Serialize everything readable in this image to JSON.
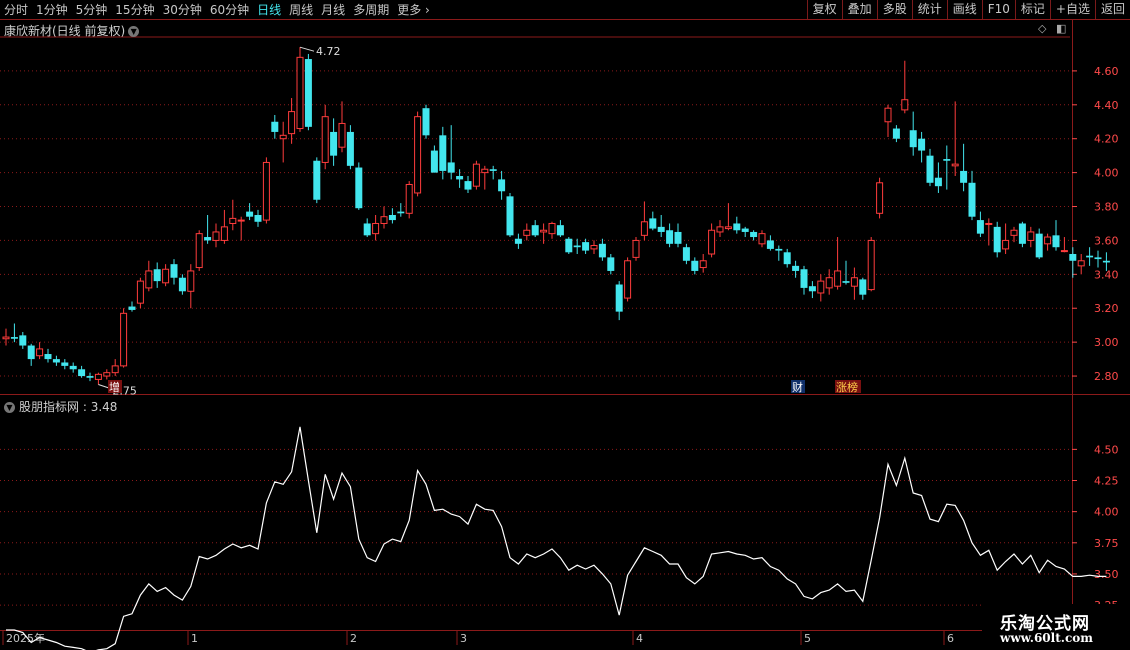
{
  "toolbar": {
    "periods": [
      "分时",
      "1分钟",
      "5分钟",
      "15分钟",
      "30分钟",
      "60分钟",
      "日线",
      "周线",
      "月线",
      "多周期",
      "更多"
    ],
    "active_period": "日线",
    "more_chevron": "›",
    "tools": [
      "复权",
      "叠加",
      "多股",
      "统计",
      "画线",
      "F10",
      "标记",
      "+自选",
      "返回"
    ]
  },
  "main_panel": {
    "title": "康欣新材(日线 前复权)",
    "y_ticks": [
      "4.60",
      "4.40",
      "4.20",
      "4.00",
      "3.80",
      "3.60",
      "3.40",
      "3.20",
      "3.00",
      "2.80"
    ],
    "high_label": "4.72",
    "low_label": "2.75",
    "markers": {
      "zeng": "增",
      "cai": "财",
      "zhangbang": "涨榜"
    }
  },
  "indicator_panel": {
    "title": "股朋指标网",
    "value": "3.48",
    "y_ticks": [
      "4.50",
      "4.25",
      "4.00",
      "3.75",
      "3.50",
      "3.25"
    ]
  },
  "x_axis": {
    "labels": [
      "2025年",
      "1",
      "2",
      "3",
      "4",
      "5",
      "6"
    ]
  },
  "watermark": {
    "line1": "乐淘公式网",
    "line2": "www.60lt.com"
  },
  "colors": {
    "up": "#ff3c3c",
    "down": "#43e6ee",
    "grid": "#8b1a1a",
    "line": "#ffffff",
    "tick": "#ff4a4a"
  },
  "chart_data": [
    {
      "type": "candlestick",
      "title": "康欣新材(日线 前复权)",
      "ylim": [
        2.7,
        4.8
      ],
      "columns": [
        "open",
        "high",
        "low",
        "close"
      ],
      "ohlc": [
        [
          3.02,
          3.08,
          2.98,
          3.03
        ],
        [
          3.03,
          3.11,
          3.0,
          3.02
        ],
        [
          3.04,
          3.06,
          2.96,
          2.98
        ],
        [
          2.98,
          2.99,
          2.86,
          2.9
        ],
        [
          2.92,
          3.0,
          2.9,
          2.96
        ],
        [
          2.93,
          2.96,
          2.88,
          2.9
        ],
        [
          2.9,
          2.92,
          2.86,
          2.88
        ],
        [
          2.88,
          2.9,
          2.84,
          2.86
        ],
        [
          2.86,
          2.88,
          2.82,
          2.84
        ],
        [
          2.84,
          2.86,
          2.79,
          2.8
        ],
        [
          2.8,
          2.82,
          2.77,
          2.79
        ],
        [
          2.78,
          2.82,
          2.75,
          2.81
        ],
        [
          2.8,
          2.84,
          2.78,
          2.82
        ],
        [
          2.82,
          2.9,
          2.8,
          2.86
        ],
        [
          2.86,
          3.2,
          2.85,
          3.17
        ],
        [
          3.21,
          3.24,
          3.18,
          3.19
        ],
        [
          3.23,
          3.38,
          3.2,
          3.36
        ],
        [
          3.32,
          3.48,
          3.3,
          3.42
        ],
        [
          3.43,
          3.47,
          3.32,
          3.36
        ],
        [
          3.35,
          3.46,
          3.33,
          3.43
        ],
        [
          3.46,
          3.49,
          3.34,
          3.38
        ],
        [
          3.38,
          3.4,
          3.28,
          3.3
        ],
        [
          3.3,
          3.46,
          3.2,
          3.42
        ],
        [
          3.44,
          3.66,
          3.42,
          3.64
        ],
        [
          3.62,
          3.75,
          3.58,
          3.6
        ],
        [
          3.6,
          3.7,
          3.56,
          3.65
        ],
        [
          3.6,
          3.78,
          3.58,
          3.68
        ],
        [
          3.7,
          3.84,
          3.66,
          3.73
        ],
        [
          3.72,
          3.74,
          3.6,
          3.72
        ],
        [
          3.77,
          3.82,
          3.72,
          3.74
        ],
        [
          3.75,
          3.78,
          3.68,
          3.71
        ],
        [
          3.72,
          4.09,
          3.7,
          4.06
        ],
        [
          4.3,
          4.34,
          4.2,
          4.24
        ],
        [
          4.2,
          4.3,
          4.06,
          4.22
        ],
        [
          4.23,
          4.44,
          4.17,
          4.36
        ],
        [
          4.26,
          4.74,
          4.24,
          4.68
        ],
        [
          4.67,
          4.7,
          4.25,
          4.27
        ],
        [
          4.07,
          4.09,
          3.82,
          3.84
        ],
        [
          4.06,
          4.4,
          4.02,
          4.33
        ],
        [
          4.24,
          4.32,
          4.04,
          4.1
        ],
        [
          4.15,
          4.42,
          4.12,
          4.29
        ],
        [
          4.24,
          4.28,
          4.02,
          4.04
        ],
        [
          4.03,
          4.06,
          3.78,
          3.79
        ],
        [
          3.7,
          3.73,
          3.62,
          3.63
        ],
        [
          3.64,
          3.75,
          3.6,
          3.7
        ],
        [
          3.7,
          3.8,
          3.67,
          3.74
        ],
        [
          3.75,
          3.79,
          3.7,
          3.72
        ],
        [
          3.77,
          3.82,
          3.74,
          3.76
        ],
        [
          3.76,
          3.95,
          3.73,
          3.93
        ],
        [
          3.88,
          4.36,
          3.86,
          4.33
        ],
        [
          4.38,
          4.4,
          4.2,
          4.22
        ],
        [
          4.13,
          4.16,
          4.0,
          4.0
        ],
        [
          4.22,
          4.27,
          3.96,
          4.01
        ],
        [
          4.06,
          4.28,
          3.96,
          4.0
        ],
        [
          3.98,
          4.02,
          3.91,
          3.96
        ],
        [
          3.95,
          3.98,
          3.88,
          3.9
        ],
        [
          3.92,
          4.07,
          3.9,
          4.05
        ],
        [
          4.0,
          4.04,
          3.9,
          4.02
        ],
        [
          4.02,
          4.04,
          3.96,
          4.01
        ],
        [
          3.96,
          4.01,
          3.84,
          3.89
        ],
        [
          3.86,
          3.88,
          3.62,
          3.63
        ],
        [
          3.61,
          3.64,
          3.55,
          3.58
        ],
        [
          3.63,
          3.7,
          3.6,
          3.66
        ],
        [
          3.69,
          3.72,
          3.62,
          3.63
        ],
        [
          3.65,
          3.7,
          3.58,
          3.66
        ],
        [
          3.64,
          3.71,
          3.61,
          3.7
        ],
        [
          3.69,
          3.72,
          3.62,
          3.63
        ],
        [
          3.61,
          3.62,
          3.52,
          3.53
        ],
        [
          3.57,
          3.61,
          3.52,
          3.56
        ],
        [
          3.59,
          3.61,
          3.52,
          3.54
        ],
        [
          3.55,
          3.6,
          3.52,
          3.57
        ],
        [
          3.58,
          3.61,
          3.48,
          3.5
        ],
        [
          3.5,
          3.52,
          3.4,
          3.42
        ],
        [
          3.34,
          3.36,
          3.13,
          3.18
        ],
        [
          3.26,
          3.5,
          3.24,
          3.48
        ],
        [
          3.5,
          3.62,
          3.48,
          3.6
        ],
        [
          3.63,
          3.83,
          3.6,
          3.71
        ],
        [
          3.73,
          3.77,
          3.66,
          3.67
        ],
        [
          3.68,
          3.75,
          3.62,
          3.65
        ],
        [
          3.66,
          3.7,
          3.56,
          3.58
        ],
        [
          3.65,
          3.7,
          3.56,
          3.58
        ],
        [
          3.56,
          3.58,
          3.46,
          3.48
        ],
        [
          3.48,
          3.5,
          3.4,
          3.42
        ],
        [
          3.44,
          3.52,
          3.41,
          3.48
        ],
        [
          3.52,
          3.7,
          3.5,
          3.66
        ],
        [
          3.65,
          3.72,
          3.62,
          3.68
        ],
        [
          3.67,
          3.82,
          3.66,
          3.68
        ],
        [
          3.7,
          3.74,
          3.64,
          3.66
        ],
        [
          3.67,
          3.68,
          3.62,
          3.65
        ],
        [
          3.65,
          3.66,
          3.6,
          3.62
        ],
        [
          3.58,
          3.66,
          3.56,
          3.64
        ],
        [
          3.6,
          3.63,
          3.54,
          3.55
        ],
        [
          3.55,
          3.57,
          3.48,
          3.54
        ],
        [
          3.53,
          3.55,
          3.44,
          3.46
        ],
        [
          3.45,
          3.48,
          3.38,
          3.42
        ],
        [
          3.43,
          3.45,
          3.28,
          3.32
        ],
        [
          3.33,
          3.36,
          3.26,
          3.3
        ],
        [
          3.29,
          3.4,
          3.24,
          3.36
        ],
        [
          3.32,
          3.43,
          3.28,
          3.38
        ],
        [
          3.33,
          3.62,
          3.31,
          3.42
        ],
        [
          3.36,
          3.48,
          3.34,
          3.35
        ],
        [
          3.33,
          3.44,
          3.25,
          3.38
        ],
        [
          3.37,
          3.38,
          3.25,
          3.28
        ],
        [
          3.31,
          3.62,
          3.3,
          3.6
        ],
        [
          3.76,
          3.97,
          3.73,
          3.94
        ],
        [
          4.3,
          4.4,
          4.21,
          4.38
        ],
        [
          4.26,
          4.28,
          4.18,
          4.2
        ],
        [
          4.37,
          4.66,
          4.35,
          4.43
        ],
        [
          4.25,
          4.36,
          4.1,
          4.15
        ],
        [
          4.2,
          4.24,
          4.06,
          4.13
        ],
        [
          4.1,
          4.14,
          3.92,
          3.94
        ],
        [
          3.97,
          4.06,
          3.88,
          3.92
        ],
        [
          4.08,
          4.16,
          3.9,
          4.07
        ],
        [
          4.04,
          4.42,
          3.98,
          4.05
        ],
        [
          4.01,
          4.17,
          3.89,
          3.94
        ],
        [
          3.94,
          4.01,
          3.72,
          3.74
        ],
        [
          3.72,
          3.77,
          3.62,
          3.64
        ],
        [
          3.7,
          3.73,
          3.57,
          3.7
        ],
        [
          3.68,
          3.71,
          3.5,
          3.53
        ],
        [
          3.55,
          3.7,
          3.52,
          3.6
        ],
        [
          3.63,
          3.68,
          3.59,
          3.66
        ],
        [
          3.7,
          3.71,
          3.56,
          3.58
        ],
        [
          3.6,
          3.68,
          3.56,
          3.65
        ],
        [
          3.64,
          3.67,
          3.49,
          3.5
        ],
        [
          3.58,
          3.64,
          3.54,
          3.62
        ],
        [
          3.63,
          3.72,
          3.54,
          3.56
        ],
        [
          3.54,
          3.62,
          3.53,
          3.54
        ],
        [
          3.52,
          3.56,
          3.38,
          3.48
        ],
        [
          3.45,
          3.52,
          3.4,
          3.48
        ],
        [
          3.51,
          3.56,
          3.45,
          3.5
        ],
        [
          3.5,
          3.54,
          3.44,
          3.49
        ],
        [
          3.48,
          3.53,
          3.42,
          3.47
        ]
      ]
    },
    {
      "type": "line",
      "title": "股朋指标网",
      "ylim": [
        3.05,
        4.8
      ],
      "series": [
        {
          "name": "股朋指标网",
          "values": [
            3.05,
            3.05,
            3.03,
            2.95,
            2.99,
            2.97,
            2.95,
            2.92,
            2.91,
            2.9,
            2.87,
            2.89,
            2.9,
            2.94,
            3.16,
            3.18,
            3.33,
            3.42,
            3.36,
            3.39,
            3.33,
            3.29,
            3.4,
            3.64,
            3.62,
            3.65,
            3.7,
            3.74,
            3.71,
            3.73,
            3.7,
            4.07,
            4.24,
            4.22,
            4.32,
            4.68,
            4.25,
            3.83,
            4.3,
            4.1,
            4.31,
            4.2,
            3.78,
            3.63,
            3.6,
            3.74,
            3.78,
            3.76,
            3.93,
            4.33,
            4.22,
            4.01,
            4.02,
            3.98,
            3.96,
            3.9,
            4.06,
            4.02,
            4.01,
            3.88,
            3.63,
            3.58,
            3.66,
            3.63,
            3.66,
            3.7,
            3.63,
            3.53,
            3.57,
            3.54,
            3.57,
            3.5,
            3.42,
            3.17,
            3.49,
            3.6,
            3.71,
            3.68,
            3.65,
            3.58,
            3.58,
            3.47,
            3.42,
            3.48,
            3.66,
            3.67,
            3.68,
            3.66,
            3.65,
            3.62,
            3.63,
            3.56,
            3.53,
            3.46,
            3.42,
            3.32,
            3.3,
            3.35,
            3.37,
            3.42,
            3.36,
            3.37,
            3.28,
            3.61,
            3.95,
            4.38,
            4.21,
            4.43,
            4.15,
            4.13,
            3.94,
            3.92,
            4.06,
            4.05,
            3.93,
            3.75,
            3.65,
            3.69,
            3.53,
            3.6,
            3.66,
            3.58,
            3.65,
            3.51,
            3.61,
            3.56,
            3.54,
            3.48,
            3.48,
            3.49,
            3.48,
            3.48
          ]
        }
      ]
    }
  ]
}
